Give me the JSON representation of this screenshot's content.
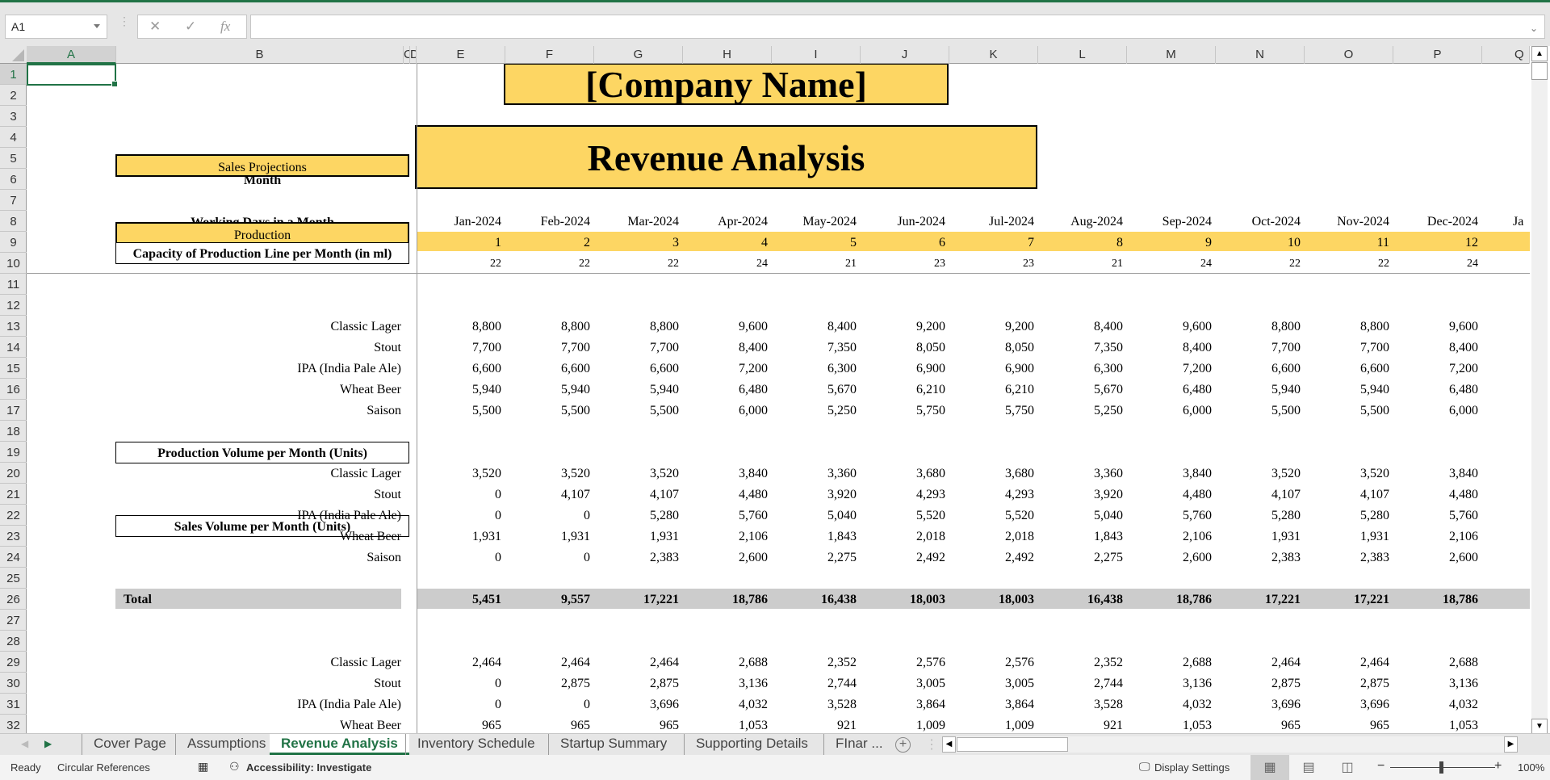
{
  "app": {
    "accent": "#217346",
    "highlight_color": "#fdd663",
    "total_band_color": "#cccccc"
  },
  "formula_bar": {
    "name_box": "A1",
    "cancel_icon": "✕",
    "enter_icon": "✓",
    "fx_label": "fx",
    "formula": ""
  },
  "columns": [
    "A",
    "B",
    "C",
    "D",
    "E",
    "F",
    "G",
    "H",
    "I",
    "J",
    "K",
    "L",
    "M",
    "N",
    "O",
    "P",
    "Q"
  ],
  "rows": [
    "1",
    "2",
    "3",
    "4",
    "5",
    "6",
    "7",
    "8",
    "9",
    "10",
    "11",
    "12",
    "13",
    "14",
    "15",
    "16",
    "17",
    "18",
    "19",
    "20",
    "21",
    "22",
    "23",
    "24",
    "25",
    "26",
    "27",
    "28",
    "29",
    "30",
    "31",
    "32"
  ],
  "sheet": {
    "company_name": "[Company Name]",
    "title": "Revenue Analysis",
    "sales_projections_label": "Sales Projections",
    "month_label": "Month",
    "working_days_label": "Working Days in a Month",
    "months": [
      "Jan-2024",
      "Feb-2024",
      "Mar-2024",
      "Apr-2024",
      "May-2024",
      "Jun-2024",
      "Jul-2024",
      "Aug-2024",
      "Sep-2024",
      "Oct-2024",
      "Nov-2024",
      "Dec-2024",
      "Ja"
    ],
    "month_numbers": [
      "1",
      "2",
      "3",
      "4",
      "5",
      "6",
      "7",
      "8",
      "9",
      "10",
      "11",
      "12"
    ],
    "working_days": [
      "22",
      "22",
      "22",
      "24",
      "21",
      "23",
      "23",
      "21",
      "24",
      "22",
      "22",
      "24"
    ],
    "production_label": "Production",
    "capacity": {
      "title": "Capacity of Production Line per Month (in ml)",
      "items": [
        {
          "name": "Classic Lager",
          "values": [
            "8,800",
            "8,800",
            "8,800",
            "9,600",
            "8,400",
            "9,200",
            "9,200",
            "8,400",
            "9,600",
            "8,800",
            "8,800",
            "9,600"
          ]
        },
        {
          "name": "Stout",
          "values": [
            "7,700",
            "7,700",
            "7,700",
            "8,400",
            "7,350",
            "8,050",
            "8,050",
            "7,350",
            "8,400",
            "7,700",
            "7,700",
            "8,400"
          ]
        },
        {
          "name": "IPA (India Pale Ale)",
          "values": [
            "6,600",
            "6,600",
            "6,600",
            "7,200",
            "6,300",
            "6,900",
            "6,900",
            "6,300",
            "7,200",
            "6,600",
            "6,600",
            "7,200"
          ]
        },
        {
          "name": "Wheat Beer",
          "values": [
            "5,940",
            "5,940",
            "5,940",
            "6,480",
            "5,670",
            "6,210",
            "6,210",
            "5,670",
            "6,480",
            "5,940",
            "5,940",
            "6,480"
          ]
        },
        {
          "name": "Saison",
          "values": [
            "5,500",
            "5,500",
            "5,500",
            "6,000",
            "5,250",
            "5,750",
            "5,750",
            "5,250",
            "6,000",
            "5,500",
            "5,500",
            "6,000"
          ]
        }
      ]
    },
    "production_volume": {
      "title": "Production Volume per Month (Units)",
      "items": [
        {
          "name": "Classic Lager",
          "values": [
            "3,520",
            "3,520",
            "3,520",
            "3,840",
            "3,360",
            "3,680",
            "3,680",
            "3,360",
            "3,840",
            "3,520",
            "3,520",
            "3,840"
          ]
        },
        {
          "name": "Stout",
          "values": [
            "0",
            "4,107",
            "4,107",
            "4,480",
            "3,920",
            "4,293",
            "4,293",
            "3,920",
            "4,480",
            "4,107",
            "4,107",
            "4,480"
          ]
        },
        {
          "name": "IPA (India Pale Ale)",
          "values": [
            "0",
            "0",
            "5,280",
            "5,760",
            "5,040",
            "5,520",
            "5,520",
            "5,040",
            "5,760",
            "5,280",
            "5,280",
            "5,760"
          ]
        },
        {
          "name": "Wheat Beer",
          "values": [
            "1,931",
            "1,931",
            "1,931",
            "2,106",
            "1,843",
            "2,018",
            "2,018",
            "1,843",
            "2,106",
            "1,931",
            "1,931",
            "2,106"
          ]
        },
        {
          "name": "Saison",
          "values": [
            "0",
            "0",
            "2,383",
            "2,600",
            "2,275",
            "2,492",
            "2,492",
            "2,275",
            "2,600",
            "2,383",
            "2,383",
            "2,600"
          ]
        }
      ],
      "total_label": "Total",
      "totals": [
        "5,451",
        "9,557",
        "17,221",
        "18,786",
        "16,438",
        "18,003",
        "18,003",
        "16,438",
        "18,786",
        "17,221",
        "17,221",
        "18,786"
      ]
    },
    "sales_volume": {
      "title": "Sales Volume per Month (Units)",
      "items": [
        {
          "name": "Classic Lager",
          "values": [
            "2,464",
            "2,464",
            "2,464",
            "2,688",
            "2,352",
            "2,576",
            "2,576",
            "2,352",
            "2,688",
            "2,464",
            "2,464",
            "2,688"
          ]
        },
        {
          "name": "Stout",
          "values": [
            "0",
            "2,875",
            "2,875",
            "3,136",
            "2,744",
            "3,005",
            "3,005",
            "2,744",
            "3,136",
            "2,875",
            "2,875",
            "3,136"
          ]
        },
        {
          "name": "IPA (India Pale Ale)",
          "values": [
            "0",
            "0",
            "3,696",
            "4,032",
            "3,528",
            "3,864",
            "3,864",
            "3,528",
            "4,032",
            "3,696",
            "3,696",
            "4,032"
          ]
        },
        {
          "name": "Wheat Beer",
          "values": [
            "965",
            "965",
            "965",
            "1,053",
            "921",
            "1,009",
            "1,009",
            "921",
            "1,053",
            "965",
            "965",
            "1,053"
          ]
        }
      ]
    }
  },
  "tabs": [
    {
      "label": "Cover Page",
      "active": false
    },
    {
      "label": "Assumptions",
      "active": false
    },
    {
      "label": "Revenue Analysis",
      "active": true
    },
    {
      "label": "Inventory Schedule",
      "active": false
    },
    {
      "label": "Startup Summary",
      "active": false
    },
    {
      "label": "Supporting Details",
      "active": false
    },
    {
      "label": "FInar ...",
      "active": false
    }
  ],
  "add_sheet_icon": "+",
  "status": {
    "ready": "Ready",
    "circular": "Circular References",
    "accessibility": "Accessibility: Investigate",
    "display_settings": "Display Settings",
    "zoom_minus": "−",
    "zoom_plus": "+",
    "zoom": "100%"
  }
}
